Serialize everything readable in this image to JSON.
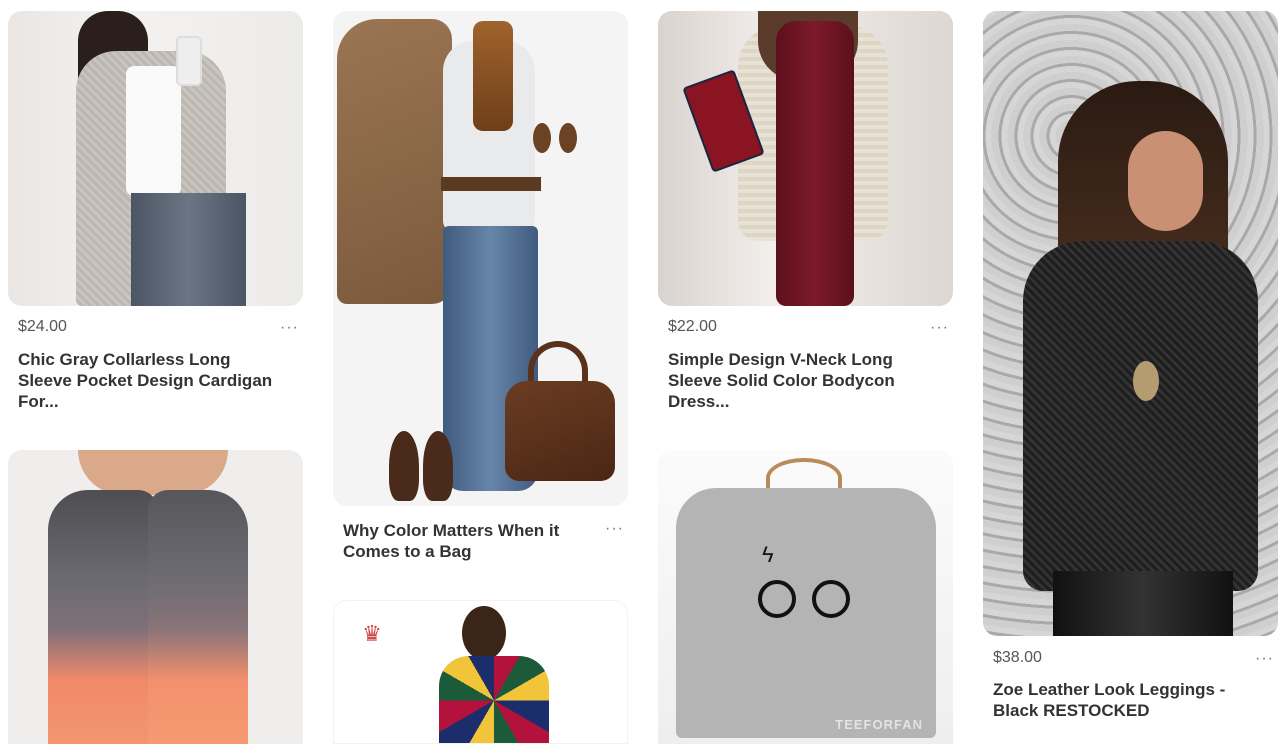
{
  "pins": [
    {
      "id": "p1",
      "image_alt": "gray cardigan outfit",
      "price": "$24.00",
      "title_lines": [
        "Chic Gray Collarless Long",
        "Sleeve Pocket Design Cardigan",
        "For..."
      ],
      "more": "···"
    },
    {
      "id": "p2",
      "image_alt": "ombre leggings",
      "price": "",
      "title_lines": [],
      "more": ""
    },
    {
      "id": "p3",
      "image_alt": "outfit collage with brown bag",
      "price": "",
      "title_lines": [
        "Why Color Matters When it",
        "Comes to a Bag"
      ],
      "more": "···"
    },
    {
      "id": "p4",
      "image_alt": "african print dress",
      "logo": "♛",
      "price": "",
      "title_lines": [],
      "more": ""
    },
    {
      "id": "p5",
      "image_alt": "burgundy bodycon dress",
      "price": "$22.00",
      "title_lines": [
        "Simple Design V-Neck Long",
        "Sleeve Solid Color Bodycon",
        "Dress..."
      ],
      "more": "···"
    },
    {
      "id": "p6",
      "image_alt": "gray t-shirt with glasses print",
      "watermark": "TEEFORFAN",
      "price": "",
      "title_lines": [],
      "more": ""
    },
    {
      "id": "p7",
      "image_alt": "black sweater with leather leggings",
      "price": "$38.00",
      "title_lines": [
        "Zoe Leather Look Leggings -",
        "Black RESTOCKED"
      ],
      "more": "···"
    }
  ]
}
